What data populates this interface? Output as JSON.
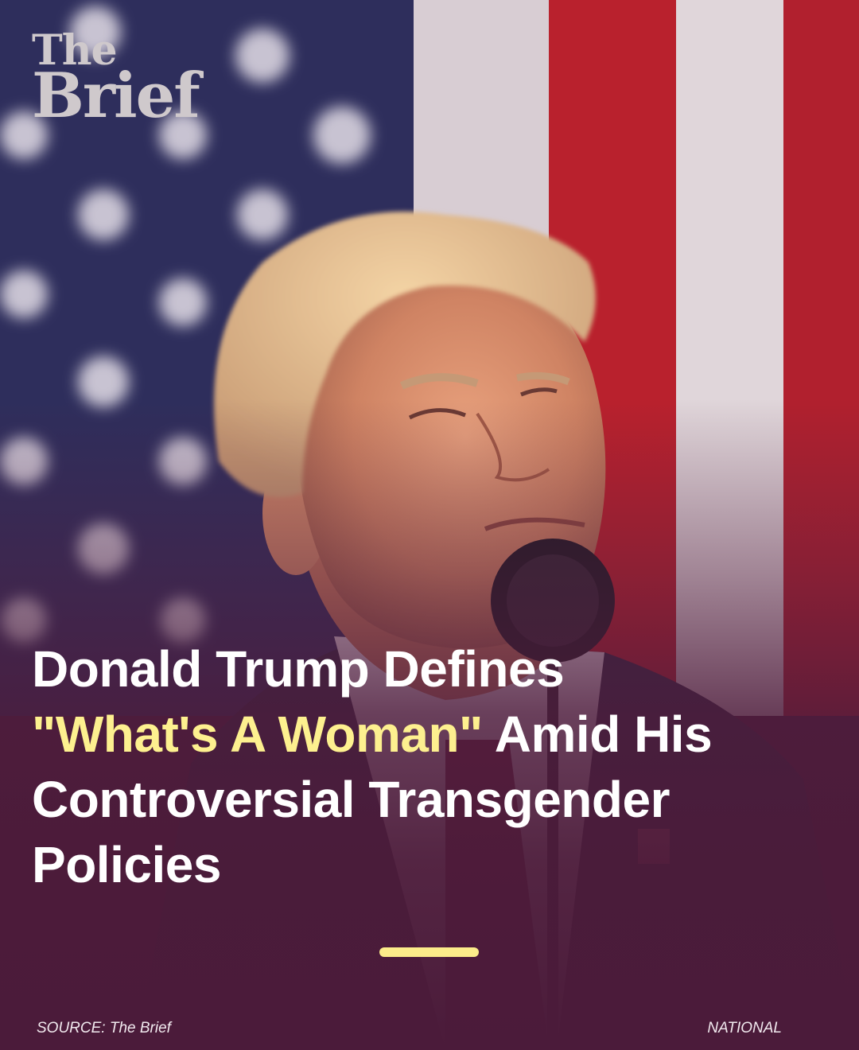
{
  "logo": {
    "line1": "The",
    "line2": "Brief"
  },
  "headline": {
    "part1": "Donald Trump Defines",
    "highlight": "\"What's A Woman\"",
    "part2": " Amid His Controversial Transgender Policies"
  },
  "footer": {
    "source": "SOURCE: The Brief",
    "category": "NATIONAL"
  },
  "colors": {
    "highlight": "#fdf08f",
    "overlay": "#4b1b3a",
    "accent_bar": "#fbec8a"
  }
}
